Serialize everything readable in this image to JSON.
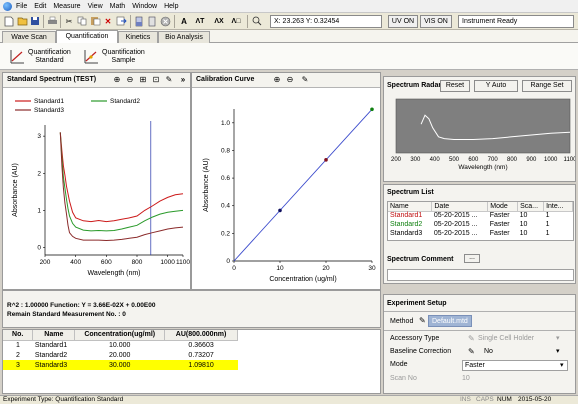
{
  "menu": {
    "items": [
      "File",
      "Edit",
      "Measure",
      "View",
      "Math",
      "Window",
      "Help"
    ]
  },
  "toolbar": {
    "coords": "X: 23.263 Y: 0.32454",
    "uv_label": "UV ON",
    "vis_label": "VIS ON",
    "status": "Instrument Ready",
    "icons": [
      "new-icon",
      "open-icon",
      "save-icon",
      "print-icon",
      "cut-icon",
      "copy-icon",
      "paste-icon",
      "delete-icon",
      "export-icon",
      "cuvette-icon",
      "blank-icon",
      "stop-icon",
      "text-a-icon",
      "text-at-icon",
      "text-ax-icon",
      "text-d-icon"
    ]
  },
  "tabs": [
    "Wave Scan",
    "Quantification",
    "Kinetics",
    "Bio Analysis"
  ],
  "ribbon": {
    "std_label_1": "Quantification",
    "std_label_2": "Standard",
    "smp_label_1": "Quantification",
    "smp_label_2": "Sample"
  },
  "std_spectrum": {
    "title": "Standard Spectrum (TEST)",
    "legend": [
      "Standard1",
      "Standard2",
      "Standard3"
    ],
    "xlabel": "Wavelength (nm)",
    "ylabel": "Absorbance (AU)",
    "xticks": [
      "200",
      "400",
      "600",
      "800",
      "1000",
      "1100"
    ],
    "yticks": [
      "0",
      "1",
      "2",
      "3"
    ],
    "colors": {
      "Standard1": "#cc1a1a",
      "Standard2": "#2a9a2a",
      "Standard3": "#8a2a2a",
      "marker": "#2233aa"
    }
  },
  "calibration": {
    "title": "Calibration Curve",
    "xlabel": "Concentration (ug/ml)",
    "ylabel": "Absorbance (AU)",
    "xticks": [
      "0",
      "10",
      "20",
      "30"
    ],
    "yticks": [
      "0",
      "0.2",
      "0.4",
      "0.6",
      "0.8",
      "1.0"
    ]
  },
  "chart_data": [
    {
      "type": "line",
      "title": "Standard Spectrum (TEST)",
      "xlabel": "Wavelength (nm)",
      "ylabel": "Absorbance (AU)",
      "xlim": [
        200,
        1100
      ],
      "ylim": [
        -0.2,
        3.3
      ],
      "grid": false,
      "legend": "top",
      "marker_x": 890,
      "series": [
        {
          "name": "Standard1",
          "x": [
            300,
            310,
            320,
            330,
            340,
            350,
            360,
            380,
            400,
            450,
            500,
            550,
            600,
            650,
            700,
            750,
            800,
            850,
            900,
            950,
            1000,
            1050,
            1100
          ],
          "y": [
            3.1,
            2.6,
            2.2,
            1.95,
            1.65,
            1.45,
            1.25,
            0.95,
            0.8,
            0.72,
            0.7,
            0.73,
            0.7,
            0.72,
            0.76,
            0.8,
            0.85,
            1.0,
            1.12,
            1.25,
            1.35,
            1.42,
            1.45
          ]
        },
        {
          "name": "Standard2",
          "x": [
            300,
            310,
            320,
            330,
            340,
            350,
            360,
            380,
            400,
            450,
            500,
            550,
            600,
            650,
            700,
            750,
            800,
            850,
            900,
            950,
            1000,
            1050,
            1100
          ],
          "y": [
            3.1,
            2.4,
            1.9,
            1.6,
            1.3,
            1.05,
            0.85,
            0.65,
            0.55,
            0.47,
            0.45,
            0.46,
            0.45,
            0.46,
            0.5,
            0.55,
            0.6,
            0.72,
            0.82,
            0.9,
            0.95,
            0.98,
            1.0
          ]
        },
        {
          "name": "Standard3",
          "x": [
            300,
            310,
            320,
            330,
            340,
            350,
            360,
            380,
            400,
            450,
            500,
            550,
            600,
            650,
            700,
            750,
            800,
            850,
            900,
            950,
            1000,
            1050,
            1100
          ],
          "y": [
            3.1,
            2.2,
            1.6,
            1.2,
            0.9,
            0.6,
            0.4,
            0.3,
            0.25,
            0.2,
            0.2,
            0.2,
            0.19,
            0.2,
            0.22,
            0.25,
            0.28,
            0.35,
            0.4,
            0.45,
            0.5,
            0.53,
            0.55
          ]
        }
      ]
    },
    {
      "type": "scatter",
      "title": "Calibration Curve",
      "xlabel": "Concentration (ug/ml)",
      "ylabel": "Absorbance (AU)",
      "xlim": [
        0,
        30
      ],
      "ylim": [
        0,
        1.1
      ],
      "points": [
        {
          "x": 10,
          "y": 0.36603,
          "color": "#101060"
        },
        {
          "x": 20,
          "y": 0.73207,
          "color": "#801020"
        },
        {
          "x": 30,
          "y": 1.0981,
          "color": "#108010"
        }
      ],
      "fit": {
        "slope": 0.0366,
        "intercept": 0,
        "x": [
          0,
          30
        ],
        "color": "#3a4acc"
      }
    },
    {
      "type": "line",
      "title": "Spectrum Radar",
      "xlabel": "Wavelength (nm)",
      "xlim": [
        200,
        1100
      ],
      "ylim": [
        0,
        3
      ],
      "series": [
        {
          "x": [
            330,
            350,
            370,
            390,
            420,
            450,
            500,
            600,
            700,
            800,
            900,
            1000,
            1100
          ],
          "y": [
            1.6,
            2.1,
            1.9,
            1.4,
            0.9,
            0.8,
            0.75,
            0.75,
            0.8,
            0.9,
            1.0,
            1.1,
            1.15
          ]
        }
      ]
    }
  ],
  "fit_info": {
    "line1": "R^2 : 1.00000  Function: Y = 3.66E-02X  + 0.00E00",
    "line2": "Remain Standard Measurement No. : 0"
  },
  "data_table": {
    "headers": [
      "No.",
      "Name",
      "Concentration(ug/ml)",
      "AU(800.000nm)"
    ],
    "rows": [
      [
        "1",
        "Standard1",
        "10.000",
        "0.36603"
      ],
      [
        "2",
        "Standard2",
        "20.000",
        "0.73207"
      ],
      [
        "3",
        "Standard3",
        "30.000",
        "1.09810"
      ]
    ],
    "highlight_color": "#ffff00"
  },
  "radar": {
    "title": "Spectrum Radar",
    "reset": "Reset",
    "yauto": "Y Auto",
    "range": "Range Set",
    "xticks": [
      "200",
      "300",
      "400",
      "500",
      "600",
      "700",
      "800",
      "900",
      "1000",
      "1100"
    ],
    "xlabel": "Wavelength (nm)"
  },
  "spectrum_list": {
    "title": "Spectrum List",
    "headers": [
      "Name",
      "Date",
      "Mode",
      "Sca...",
      "Inte..."
    ],
    "rows": [
      [
        "Standard1",
        "05-20-2015 ...",
        "Faster",
        "10",
        "1"
      ],
      [
        "Standard2",
        "05-20-2015 ...",
        "Faster",
        "10",
        "1"
      ],
      [
        "Standard3",
        "05-20-2015 ...",
        "Faster",
        "10",
        "1"
      ]
    ],
    "row_colors": [
      "#c01010",
      "#108010",
      "#000000"
    ]
  },
  "comment": {
    "title": "Spectrum Comment",
    "btn": "..."
  },
  "setup": {
    "title": "Experiment Setup",
    "method_label": "Method",
    "method_value": "Default.mtd",
    "rows": [
      {
        "label": "Accessory Type",
        "value": "Single Cell Holder"
      },
      {
        "label": "Baseline Correction",
        "value": "No"
      },
      {
        "label": "Mode",
        "value": "Faster"
      },
      {
        "label": "Scan No",
        "value": "10"
      }
    ]
  },
  "statusbar": {
    "left": "Experiment Type: Quantification Standard",
    "ins": "INS",
    "caps": "CAPS",
    "num": "NUM",
    "date": "2015-05-20"
  }
}
